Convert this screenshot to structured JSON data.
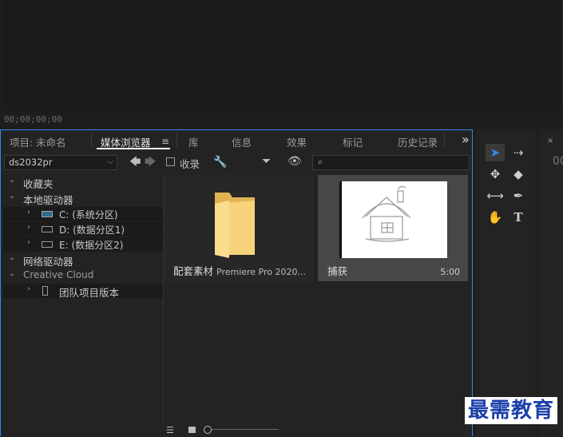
{
  "monitor": {
    "timecode": "00;00;00;00"
  },
  "tabs": {
    "project": "项目: 未命名",
    "media_browser": "媒体浏览器",
    "library": "库",
    "info": "信息",
    "effects": "效果",
    "markers": "标记",
    "history": "历史记录",
    "overflow": "»"
  },
  "toolbar": {
    "path": "ds2032pr",
    "favorites_label": "收录"
  },
  "tree": {
    "favorites": "收藏夹",
    "local_drives": "本地驱动器",
    "drives": [
      {
        "label": "C: (系统分区)"
      },
      {
        "label": "D: (数据分区1)"
      },
      {
        "label": "E: (数据分区2)"
      }
    ],
    "network_drives": "网络驱动器",
    "creative_cloud": "Creative Cloud",
    "team_versions": "团队项目版本"
  },
  "grid": {
    "items": [
      {
        "name": "配套素材",
        "sub": "Premiere Pro 2020..."
      },
      {
        "name": "捕获",
        "duration": "5:00"
      }
    ]
  },
  "right_panel": {
    "label": "00"
  },
  "watermark": "最需教育",
  "colors": {
    "accent": "#2d8ceb",
    "folder": "#f3c96a",
    "watermark": "#1a3fa8"
  }
}
